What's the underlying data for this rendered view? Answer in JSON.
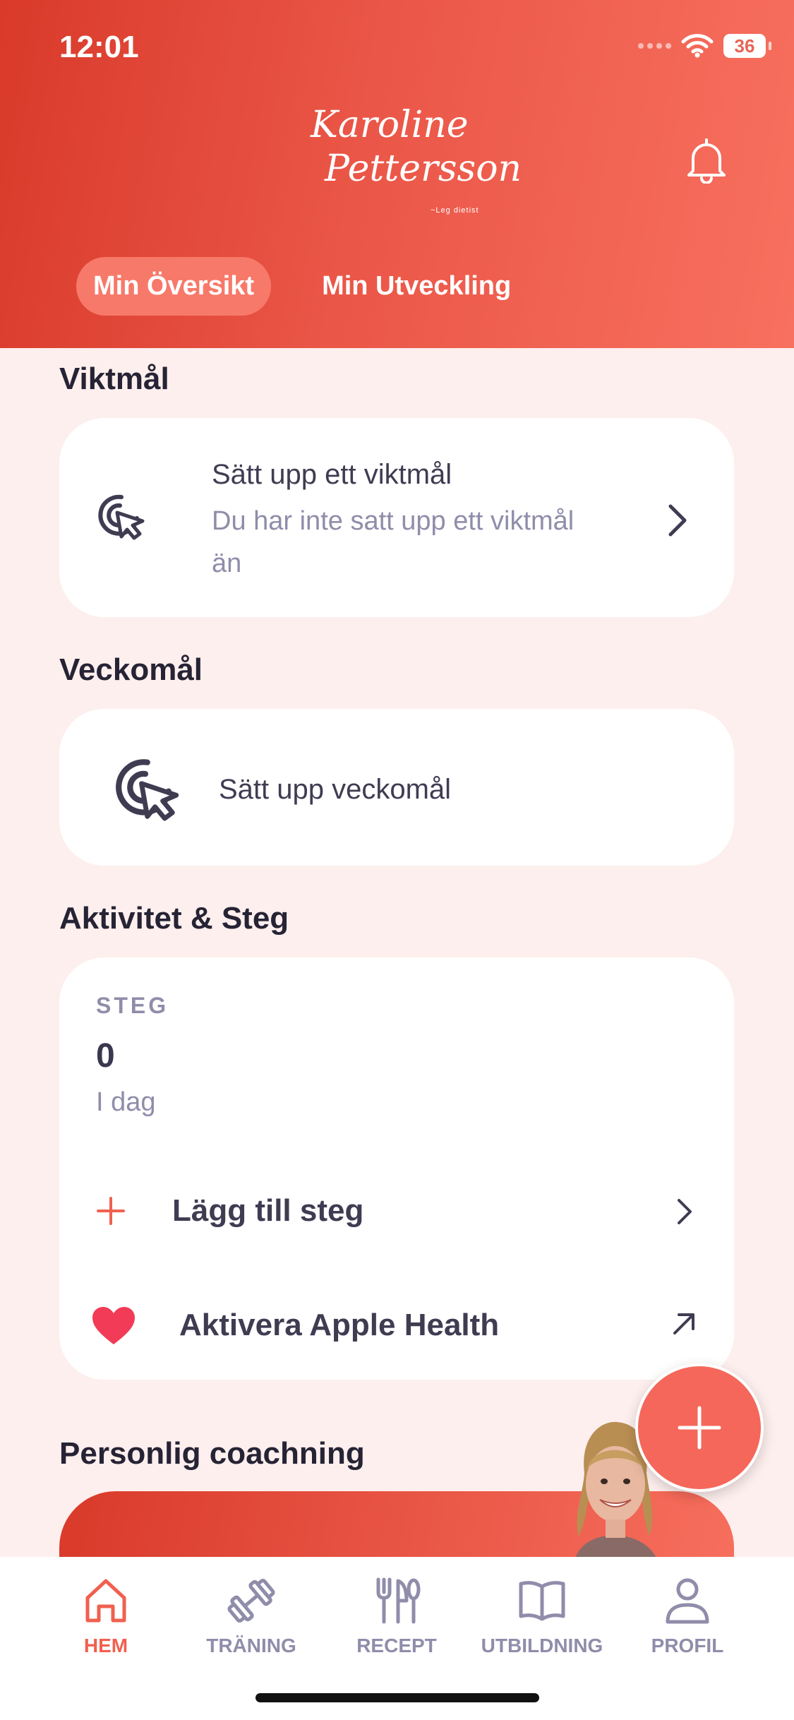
{
  "status": {
    "time": "12:01",
    "battery": "36"
  },
  "brand": {
    "name_line1": "Karoline",
    "name_line2": "Pettersson",
    "subtitle": "~Leg dietist"
  },
  "tabs": [
    {
      "label": "Min Översikt",
      "active": true
    },
    {
      "label": "Min Utveckling",
      "active": false
    }
  ],
  "weight_goal": {
    "section_title": "Viktmål",
    "title": "Sätt upp ett viktmål",
    "subtitle": "Du har inte satt upp ett viktmål än"
  },
  "weekly_goal": {
    "section_title": "Veckomål",
    "label": "Sätt upp veckomål"
  },
  "activity": {
    "section_title": "Aktivitet & Steg",
    "steps_label": "STEG",
    "steps_value": "0",
    "steps_period": "I dag",
    "add_steps_label": "Lägg till steg",
    "apple_health_label": "Aktivera Apple Health"
  },
  "coaching": {
    "section_title": "Personlig coachning"
  },
  "tabbar": [
    {
      "label": "HEM",
      "icon": "home-icon",
      "active": true
    },
    {
      "label": "TRÄNING",
      "icon": "dumbbell-icon",
      "active": false
    },
    {
      "label": "RECEPT",
      "icon": "utensils-icon",
      "active": false
    },
    {
      "label": "UTBILDNING",
      "icon": "book-icon",
      "active": false
    },
    {
      "label": "PROFIL",
      "icon": "person-icon",
      "active": false
    }
  ],
  "colors": {
    "accent": "#f0604f",
    "header_start": "#d93a2a",
    "header_end": "#f8705f",
    "background": "#fdefed",
    "muted_text": "#8f8daa",
    "heart": "#f23b57"
  }
}
